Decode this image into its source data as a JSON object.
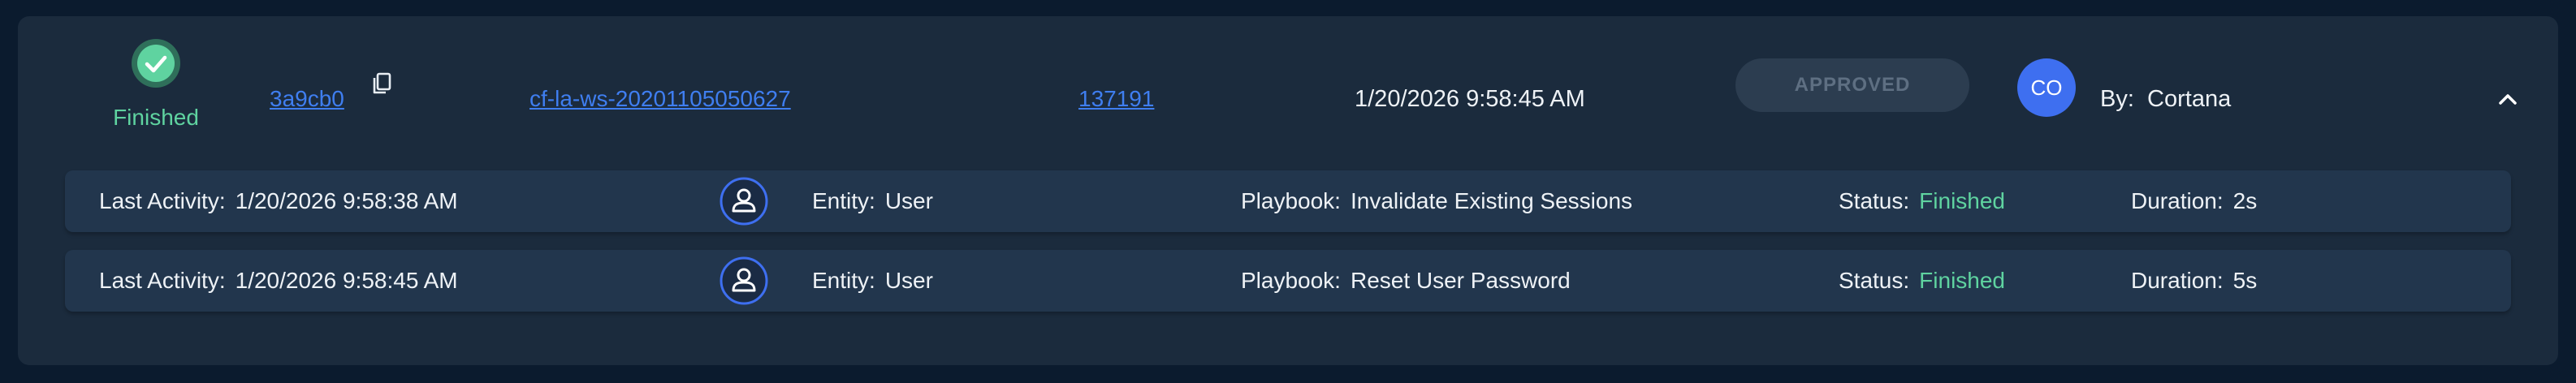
{
  "header": {
    "status_label": "Finished",
    "commit_id": "3a9cb0",
    "workspace": "cf-la-ws-20201105050627",
    "incident_number": "137191",
    "timestamp": "1/20/2026 9:58:45 AM",
    "approval_label": "APPROVED",
    "avatar_initials": "CO",
    "by_label": "By:",
    "by_name": "Cortana"
  },
  "activities": [
    {
      "last_activity_label": "Last Activity:",
      "last_activity_value": "1/20/2026 9:58:38 AM",
      "entity_label": "Entity:",
      "entity_value": "User",
      "playbook_label": "Playbook:",
      "playbook_value": "Invalidate Existing Sessions",
      "status_label": "Status:",
      "status_value": "Finished",
      "duration_label": "Duration:",
      "duration_value": "2s"
    },
    {
      "last_activity_label": "Last Activity:",
      "last_activity_value": "1/20/2026 9:58:45 AM",
      "entity_label": "Entity:",
      "entity_value": "User",
      "playbook_label": "Playbook:",
      "playbook_value": "Reset User Password",
      "status_label": "Status:",
      "status_value": "Finished",
      "duration_label": "Duration:",
      "duration_value": "5s"
    }
  ],
  "icons": {
    "status": "check-circle-icon",
    "copy": "copy-icon",
    "collapse": "chevron-up-icon",
    "entity": "user-icon"
  },
  "colors": {
    "background": "#0b1b2e",
    "card": "#1b2b3d",
    "row": "#22364d",
    "success": "#5fd3a0",
    "link": "#3f7ef0",
    "avatar": "#3e6ff0",
    "approved_bg": "#2c3d50",
    "approved_text": "#5e6f82"
  }
}
